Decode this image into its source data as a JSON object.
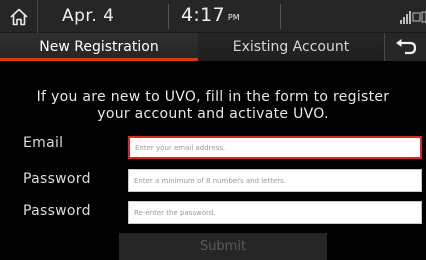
{
  "statusbar": {
    "home_icon": "home-icon",
    "date": "Apr. 4",
    "time": "4:17",
    "ampm": "PM",
    "signal_icon": "signal-icon"
  },
  "tabs": [
    {
      "label": "New Registration",
      "active": true
    },
    {
      "label": "Existing Account",
      "active": false
    }
  ],
  "back_icon": "back-arrow-icon",
  "intro": {
    "line1": "If you are new to UVO, fill in the form to register",
    "line2": "your account and activate UVO."
  },
  "form": {
    "email": {
      "label": "Email",
      "placeholder": "Enter your email address."
    },
    "password": {
      "label": "Password",
      "placeholder": "Enter a minimum of 8 numbers and letters."
    },
    "confirm_password": {
      "label": "Password",
      "placeholder": "Re-enter the password."
    },
    "submit_label": "Submit"
  },
  "colors": {
    "accent": "#e0351f",
    "focus_border": "#d8262a",
    "background": "#000000",
    "bar": "#262626"
  }
}
